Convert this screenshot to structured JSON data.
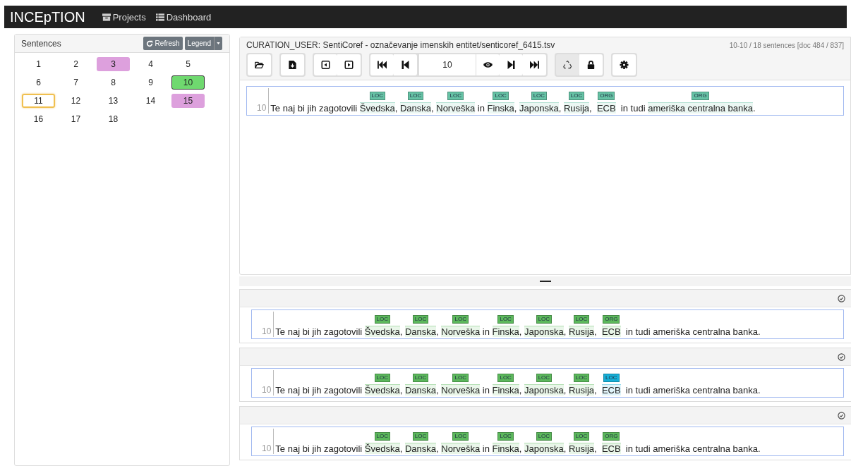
{
  "navbar": {
    "brand": "INCEpTION",
    "links": [
      {
        "kind": "projects",
        "label": "Projects"
      },
      {
        "kind": "dashboard",
        "label": "Dashboard"
      }
    ]
  },
  "sentences_panel": {
    "title": "Sentences",
    "refresh": "Refresh",
    "legend": "Legend",
    "items": [
      {
        "label": "1",
        "curated": false,
        "current": false,
        "focused": false
      },
      {
        "label": "2",
        "curated": false,
        "current": false,
        "focused": false
      },
      {
        "label": "3",
        "curated": true,
        "current": false,
        "focused": false
      },
      {
        "label": "4",
        "curated": false,
        "current": false,
        "focused": false
      },
      {
        "label": "5",
        "curated": false,
        "current": false,
        "focused": false
      },
      {
        "label": "6",
        "curated": false,
        "current": false,
        "focused": false
      },
      {
        "label": "7",
        "curated": false,
        "current": false,
        "focused": false
      },
      {
        "label": "8",
        "curated": false,
        "current": false,
        "focused": false
      },
      {
        "label": "9",
        "curated": false,
        "current": false,
        "focused": false
      },
      {
        "label": "10",
        "curated": false,
        "current": true,
        "focused": false
      },
      {
        "label": "11",
        "curated": false,
        "current": false,
        "focused": true
      },
      {
        "label": "12",
        "curated": false,
        "current": false,
        "focused": false
      },
      {
        "label": "13",
        "curated": false,
        "current": false,
        "focused": false
      },
      {
        "label": "14",
        "curated": false,
        "current": false,
        "focused": false
      },
      {
        "label": "15",
        "curated": true,
        "current": false,
        "focused": false
      },
      {
        "label": "16",
        "curated": false,
        "current": false,
        "focused": false
      },
      {
        "label": "17",
        "curated": false,
        "current": false,
        "focused": false
      },
      {
        "label": "18",
        "curated": false,
        "current": false,
        "focused": false
      }
    ]
  },
  "editor": {
    "title": "CURATION_USER: SentiCoref - označevanje imenskih entitet/senticoref_6415.tsv",
    "position": "10-10 / 18 sentences [doc 484 / 837]",
    "toolbar": [
      {
        "buttons": [
          {
            "kind": "open",
            "pressed": false
          }
        ]
      },
      {
        "buttons": [
          {
            "kind": "export",
            "pressed": false
          }
        ]
      },
      {
        "buttons": [
          {
            "kind": "prev-doc",
            "pressed": false
          },
          {
            "kind": "next-doc",
            "pressed": false
          }
        ]
      },
      {
        "buttons": [
          {
            "kind": "first",
            "pressed": false
          },
          {
            "kind": "prev",
            "pressed": false
          },
          {
            "kind": "page",
            "value": "10"
          },
          {
            "kind": "eye",
            "pressed": false
          },
          {
            "kind": "next",
            "pressed": false
          },
          {
            "kind": "last",
            "pressed": false
          }
        ]
      },
      {
        "buttons": [
          {
            "kind": "recycle",
            "pressed": true
          },
          {
            "kind": "lock",
            "pressed": false
          }
        ]
      },
      {
        "buttons": [
          {
            "kind": "settings",
            "pressed": false
          }
        ]
      }
    ],
    "sentence": {
      "number": "10",
      "segments": [
        {
          "text": "Te naj bi jih zagotovili "
        },
        {
          "text": "Švedska",
          "label": "LOC",
          "color": "#66c2a5"
        },
        {
          "text": ", "
        },
        {
          "text": "Danska",
          "label": "LOC",
          "color": "#66c2a5"
        },
        {
          "text": ", "
        },
        {
          "text": "Norveška",
          "label": "LOC",
          "color": "#66c2a5"
        },
        {
          "text": " in "
        },
        {
          "text": "Finska",
          "label": "LOC",
          "color": "#66c2a5"
        },
        {
          "text": ", "
        },
        {
          "text": "Japonska",
          "label": "LOC",
          "color": "#66c2a5"
        },
        {
          "text": ", "
        },
        {
          "text": "Rusija",
          "label": "LOC",
          "color": "#66c2a5"
        },
        {
          "text": ",  "
        },
        {
          "text": "ECB",
          "label": "ORG",
          "color": "#66c2a5"
        },
        {
          "text": "  in tudi "
        },
        {
          "text": "ameriška centralna banka",
          "label": "ORG",
          "color": "#66c2a5"
        },
        {
          "text": "."
        }
      ]
    }
  },
  "curation_panels": [
    {
      "sentence": {
        "number": "10",
        "segments": [
          {
            "text": "Te naj bi jih zagotovili "
          },
          {
            "text": "Švedska",
            "label": "LOC",
            "color": "#5cb85c"
          },
          {
            "text": ", "
          },
          {
            "text": "Danska",
            "label": "LOC",
            "color": "#5cb85c"
          },
          {
            "text": ", "
          },
          {
            "text": "Norveška",
            "label": "LOC",
            "color": "#5cb85c"
          },
          {
            "text": " in "
          },
          {
            "text": "Finska",
            "label": "LOC",
            "color": "#5cb85c"
          },
          {
            "text": ", "
          },
          {
            "text": "Japonska",
            "label": "LOC",
            "color": "#5cb85c"
          },
          {
            "text": ", "
          },
          {
            "text": "Rusija",
            "label": "LOC",
            "color": "#5cb85c"
          },
          {
            "text": ",  "
          },
          {
            "text": "ECB",
            "label": "ORG",
            "color": "#5cb85c"
          },
          {
            "text": "  in tudi ameriška centralna banka."
          }
        ]
      }
    },
    {
      "sentence": {
        "number": "10",
        "segments": [
          {
            "text": "Te naj bi jih zagotovili "
          },
          {
            "text": "Švedska",
            "label": "LOC",
            "color": "#5cb85c"
          },
          {
            "text": ", "
          },
          {
            "text": "Danska",
            "label": "LOC",
            "color": "#5cb85c"
          },
          {
            "text": ", "
          },
          {
            "text": "Norveška",
            "label": "LOC",
            "color": "#5cb85c"
          },
          {
            "text": " in "
          },
          {
            "text": "Finska",
            "label": "LOC",
            "color": "#5cb85c"
          },
          {
            "text": ", "
          },
          {
            "text": "Japonska",
            "label": "LOC",
            "color": "#5cb85c"
          },
          {
            "text": ", "
          },
          {
            "text": "Rusija",
            "label": "LOC",
            "color": "#5cb85c"
          },
          {
            "text": ",  "
          },
          {
            "text": "ECB",
            "label": "LOC",
            "color": "#17b0d8"
          },
          {
            "text": "  in tudi ameriška centralna banka."
          }
        ]
      }
    },
    {
      "sentence": {
        "number": "10",
        "segments": [
          {
            "text": "Te naj bi jih zagotovili "
          },
          {
            "text": "Švedska",
            "label": "LOC",
            "color": "#5cb85c"
          },
          {
            "text": ", "
          },
          {
            "text": "Danska",
            "label": "LOC",
            "color": "#5cb85c"
          },
          {
            "text": ", "
          },
          {
            "text": "Norveška",
            "label": "LOC",
            "color": "#5cb85c"
          },
          {
            "text": " in "
          },
          {
            "text": "Finska",
            "label": "LOC",
            "color": "#5cb85c"
          },
          {
            "text": ", "
          },
          {
            "text": "Japonska",
            "label": "LOC",
            "color": "#5cb85c"
          },
          {
            "text": ", "
          },
          {
            "text": "Rusija",
            "label": "LOC",
            "color": "#5cb85c"
          },
          {
            "text": ",  "
          },
          {
            "text": "ECB",
            "label": "ORG",
            "color": "#5cb85c"
          },
          {
            "text": "  in tudi ameriška centralna banka."
          }
        ]
      }
    }
  ]
}
